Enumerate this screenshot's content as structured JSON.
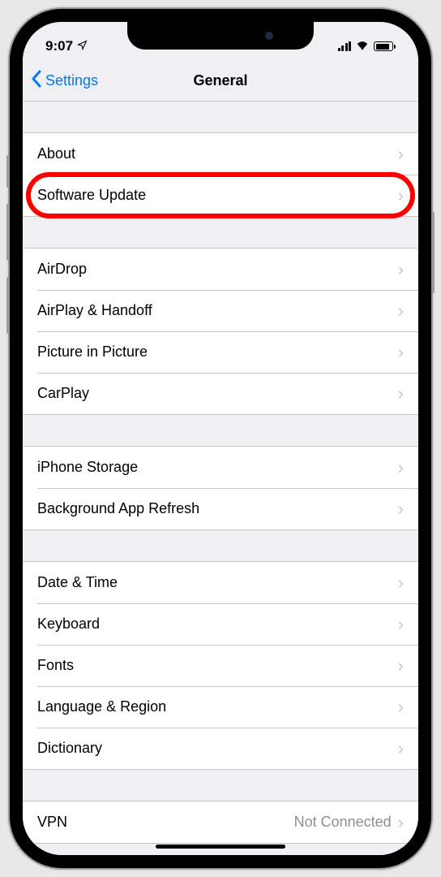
{
  "status_bar": {
    "time": "9:07",
    "location_icon": "✈︎"
  },
  "nav": {
    "back_label": "Settings",
    "title": "General"
  },
  "groups": [
    {
      "items": [
        {
          "label": "About"
        },
        {
          "label": "Software Update",
          "highlighted": true
        }
      ]
    },
    {
      "items": [
        {
          "label": "AirDrop"
        },
        {
          "label": "AirPlay & Handoff"
        },
        {
          "label": "Picture in Picture"
        },
        {
          "label": "CarPlay"
        }
      ]
    },
    {
      "items": [
        {
          "label": "iPhone Storage"
        },
        {
          "label": "Background App Refresh"
        }
      ]
    },
    {
      "items": [
        {
          "label": "Date & Time"
        },
        {
          "label": "Keyboard"
        },
        {
          "label": "Fonts"
        },
        {
          "label": "Language & Region"
        },
        {
          "label": "Dictionary"
        }
      ]
    },
    {
      "items": [
        {
          "label": "VPN",
          "value": "Not Connected"
        }
      ]
    }
  ]
}
